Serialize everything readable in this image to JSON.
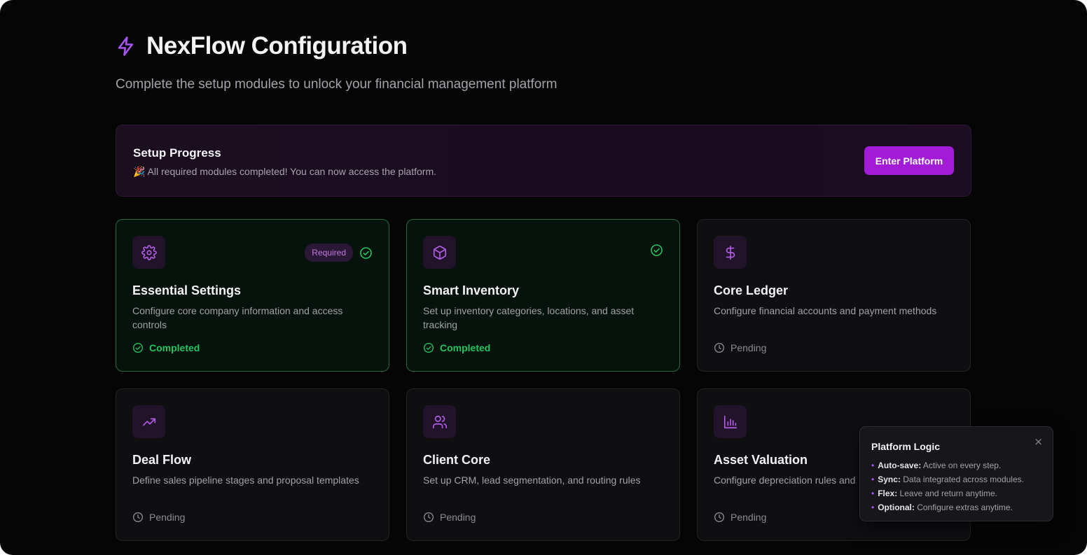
{
  "header": {
    "title": "NexFlow Configuration",
    "subtitle": "Complete the setup modules to unlock your financial management platform",
    "icon": "lightning-bolt-icon"
  },
  "progress": {
    "title": "Setup Progress",
    "message": "🎉 All required modules completed! You can now access the platform.",
    "button_label": "Enter Platform"
  },
  "colors": {
    "accent": "#a21bd6",
    "success": "#22c55e",
    "background": "#050506"
  },
  "modules": [
    {
      "title": "Essential Settings",
      "description": "Configure core company information and access controls",
      "status": "Completed",
      "badge": "Required",
      "icon": "gear-icon"
    },
    {
      "title": "Smart Inventory",
      "description": "Set up inventory categories, locations, and asset tracking",
      "status": "Completed",
      "icon": "package-icon"
    },
    {
      "title": "Core Ledger",
      "description": "Configure financial accounts and payment methods",
      "status": "Pending",
      "icon": "dollar-icon"
    },
    {
      "title": "Deal Flow",
      "description": "Define sales pipeline stages and proposal templates",
      "status": "Pending",
      "icon": "trending-up-icon"
    },
    {
      "title": "Client Core",
      "description": "Set up CRM, lead segmentation, and routing rules",
      "status": "Pending",
      "icon": "users-icon"
    },
    {
      "title": "Asset Valuation",
      "description": "Configure depreciation rules and",
      "status": "Pending",
      "icon": "bar-chart-icon"
    }
  ],
  "popup": {
    "title": "Platform Logic",
    "close": "×",
    "items": [
      {
        "key": "Auto-save:",
        "text": " Active on every step."
      },
      {
        "key": "Sync:",
        "text": " Data integrated across modules."
      },
      {
        "key": "Flex:",
        "text": " Leave and return anytime."
      },
      {
        "key": "Optional:",
        "text": " Configure extras anytime."
      }
    ]
  }
}
